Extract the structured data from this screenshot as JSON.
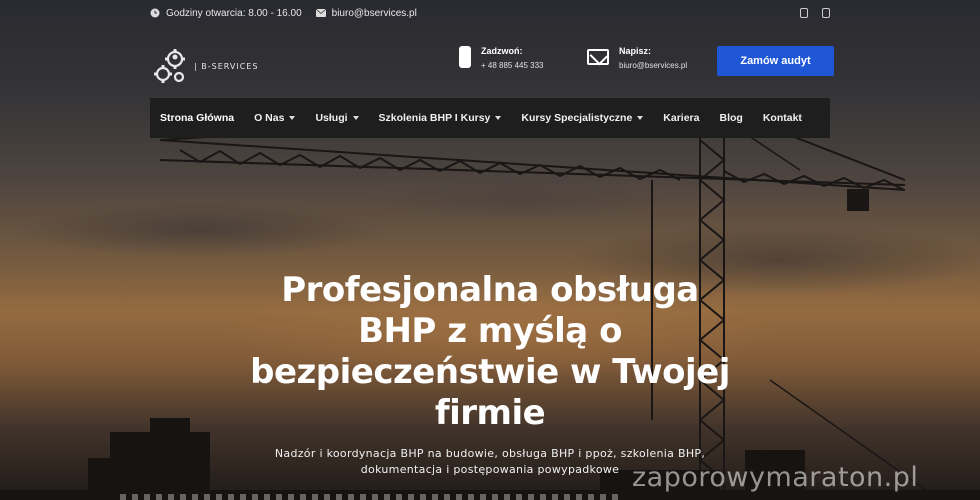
{
  "topbar": {
    "hours": "Godziny otwarcia: 8.00 - 16.00",
    "email": "biuro@bservices.pl",
    "hours_icon": "clock-icon",
    "email_icon": "envelope-icon"
  },
  "header": {
    "brand": "| B-SERVICES",
    "phone_title": "Zadzwoń:",
    "phone_value": "+ 48 885 445 333",
    "mail_title": "Napisz:",
    "mail_value": "biuro@bservices.pl",
    "cta_label": "Zamów audyt"
  },
  "nav": {
    "items": [
      {
        "label": "Strona Główna",
        "dropdown": false
      },
      {
        "label": "O Nas",
        "dropdown": true
      },
      {
        "label": "Usługi",
        "dropdown": true
      },
      {
        "label": "Szkolenia BHP I Kursy",
        "dropdown": true
      },
      {
        "label": "Kursy Specjalistyczne",
        "dropdown": true
      },
      {
        "label": "Kariera",
        "dropdown": false
      },
      {
        "label": "Blog",
        "dropdown": false
      },
      {
        "label": "Kontakt",
        "dropdown": false
      }
    ]
  },
  "hero": {
    "title": "Profesjonalna obsługa BHP z myślą o bezpieczeństwie w Twojej firmie",
    "subtitle": "Nadzór i koordynacja BHP na budowie, obsługa BHP i ppoż, szkolenia BHP, dokumentacja i postępowania powypadkowe"
  },
  "watermark": "zaporowymaraton.pl",
  "colors": {
    "accent": "#1f56d6",
    "nav_bg": "#1e1e1f"
  }
}
